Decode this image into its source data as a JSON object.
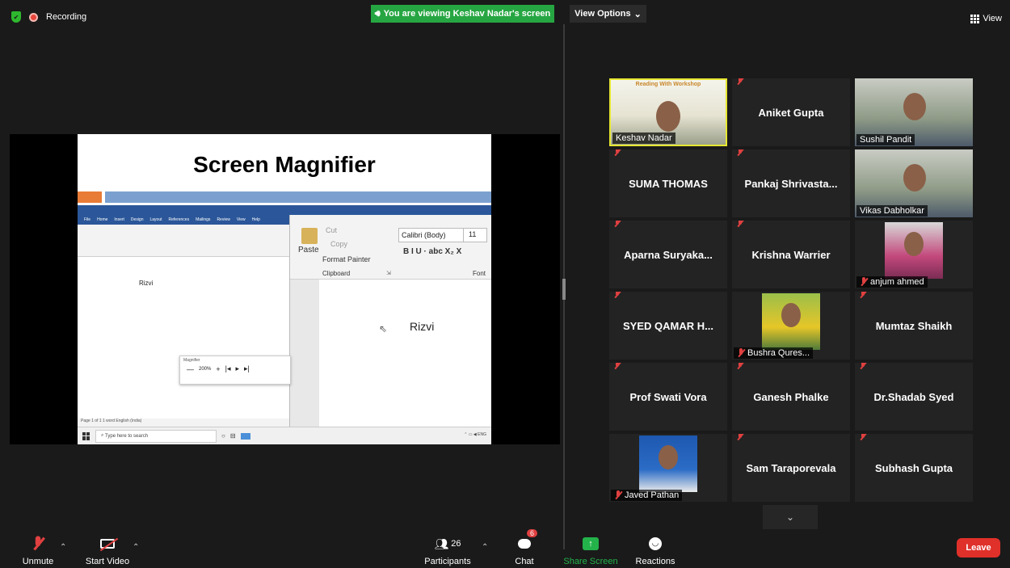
{
  "top": {
    "recording_label": "Recording",
    "banner_text": "You are viewing Keshav Nadar's screen",
    "view_options_label": "View Options",
    "view_label": "View"
  },
  "shared_screen": {
    "slide_title": "Screen Magnifier",
    "word_doc_text": "Rizvi",
    "magnified_text": "Rizvi",
    "paste_label": "Paste",
    "cut_label": "Cut",
    "copy_label": "Copy",
    "format_painter_label": "Format Painter",
    "clipboard_label": "Clipboard",
    "font_name": "Calibri (Body)",
    "font_size": "11",
    "font_label": "Font",
    "font_format": "B  I  U  ·  abc  X₂  X",
    "magnifier_title": "Magnifier",
    "magnifier_zoom": "200%",
    "taskbar_search": "Type here to search",
    "status_bar": "Page 1 of 1   1 word   English (India)"
  },
  "gallery": {
    "participants": [
      {
        "name": "Keshav Nadar",
        "video": true,
        "muted": false,
        "active": true
      },
      {
        "name": "Aniket Gupta",
        "video": false,
        "muted": true
      },
      {
        "name": "Sushil Pandit",
        "video": true,
        "muted": false
      },
      {
        "name": "SUMA THOMAS",
        "video": false,
        "muted": true
      },
      {
        "name": "Pankaj  Shrivasta...",
        "video": false,
        "muted": true
      },
      {
        "name": "Vikas Dabholkar",
        "video": true,
        "muted": false
      },
      {
        "name": "Aparna  Suryaka...",
        "video": false,
        "muted": true
      },
      {
        "name": "Krishna Warrier",
        "video": false,
        "muted": true
      },
      {
        "name": "anjum ahmed",
        "video": true,
        "muted": true
      },
      {
        "name": "SYED QAMAR H...",
        "video": false,
        "muted": true
      },
      {
        "name": "Bushra Qures...",
        "video": true,
        "muted": true
      },
      {
        "name": "Mumtaz Shaikh",
        "video": false,
        "muted": true
      },
      {
        "name": "Prof Swati Vora",
        "video": false,
        "muted": true
      },
      {
        "name": "Ganesh Phalke",
        "video": false,
        "muted": true
      },
      {
        "name": "Dr.Shadab Syed",
        "video": false,
        "muted": true
      },
      {
        "name": "Javed Pathan",
        "video": true,
        "muted": true
      },
      {
        "name": "Sam Taraporevala",
        "video": false,
        "muted": true
      },
      {
        "name": "Subhash Gupta",
        "video": false,
        "muted": true
      }
    ],
    "active_video_text": "Reading With     Workshop"
  },
  "toolbar": {
    "unmute_label": "Unmute",
    "start_video_label": "Start Video",
    "participants_label": "Participants",
    "participants_count": "26",
    "chat_label": "Chat",
    "chat_badge": "6",
    "share_screen_label": "Share Screen",
    "reactions_label": "Reactions",
    "leave_label": "Leave"
  },
  "colors": {
    "banner_green": "#26a642",
    "active_border": "#e7e732",
    "leave_red": "#e0302a",
    "muted_red": "#e04040"
  }
}
